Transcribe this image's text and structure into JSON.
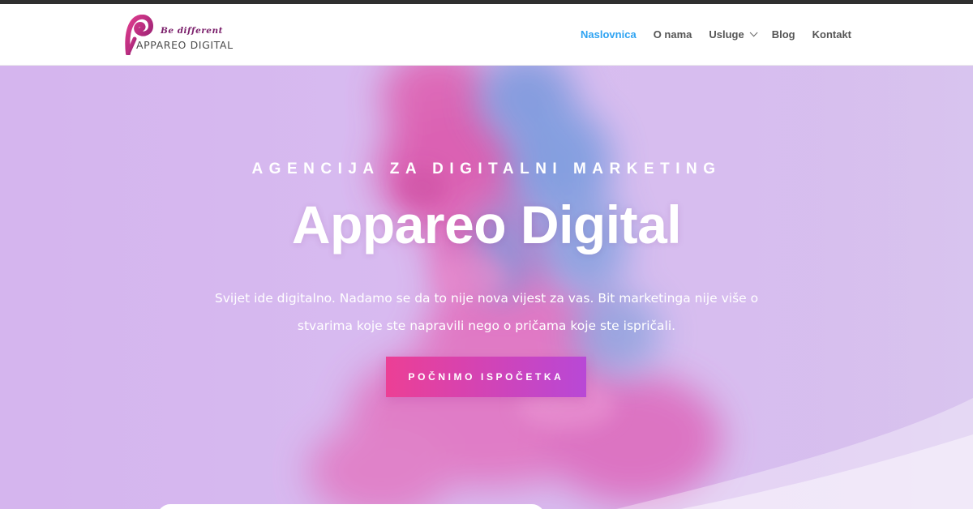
{
  "header": {
    "logo": {
      "tagline": "Be different",
      "name": "APPAREO DIGITAL"
    },
    "nav": [
      {
        "label": "Naslovnica",
        "active": true
      },
      {
        "label": "O nama"
      },
      {
        "label": "Usluge",
        "has_dropdown": true
      },
      {
        "label": "Blog"
      },
      {
        "label": "Kontakt"
      }
    ]
  },
  "hero": {
    "eyebrow": "AGENCIJA ZA DIGITALNI MARKETING",
    "title": "Appareo Digital",
    "text": "Svijet ide digitalno. Nadamo se da to nije nova vijest za vas. Bit marketinga nije više o stvarima koje ste napravili nego o pričama koje ste ispričali.",
    "cta_label": "POČNIMO ISPOČETKA"
  },
  "colors": {
    "nav_active": "#2ea3f2",
    "cta_gradient_start": "#ec3f95",
    "cta_gradient_end": "#b848d6",
    "hero_background": "#d6bbef",
    "logo_pink": "#d6246e"
  },
  "icons": [
    "chevron-down-icon",
    "logo-mark-icon"
  ]
}
